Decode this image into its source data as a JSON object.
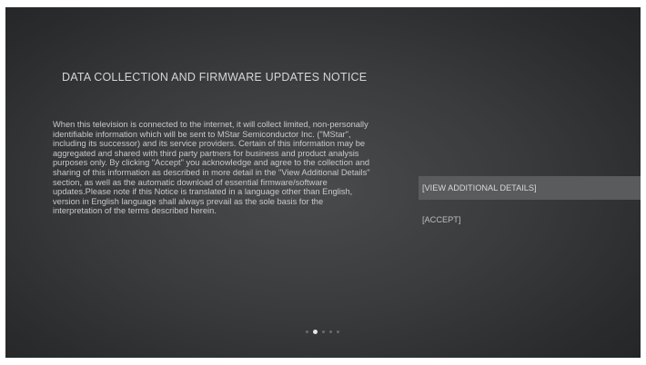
{
  "notice": {
    "title": "DATA COLLECTION AND FIRMWARE UPDATES NOTICE",
    "body": "When this television is connected to the internet, it will collect limited, non-personally identifiable information which will be sent to MStar Semiconductor Inc. (\"MStar\", including its successor) and its service providers. Certain of this information may be aggregated and shared with third party partners for business and product analysis purposes only. By clicking \"Accept\" you acknowledge and agree to the collection and sharing of this information as described in more detail in the \"View Additional Details\" section, as well as the automatic download of essential firmware/software updates.Please note if this Notice is translated in a language other than English, version in English language shall always prevail as the sole basis for the interpretation of the terms described herein."
  },
  "options": {
    "view_details": "[VIEW ADDITIONAL DETAILS]",
    "accept": "[ACCEPT]"
  },
  "pagination": {
    "total_pages": 5,
    "current_page": 2
  },
  "colors": {
    "background": "#3a3b3d",
    "focus_highlight": "#5a5b5d",
    "text": "#c9c9c9"
  }
}
